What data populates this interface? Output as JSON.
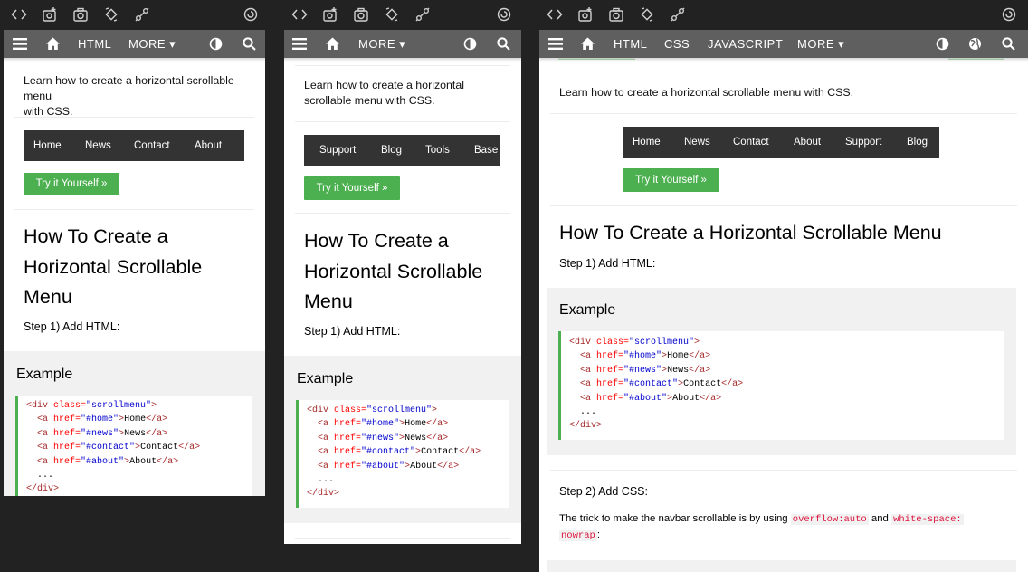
{
  "nav_left": {
    "html": "HTML",
    "more": "MORE ▾"
  },
  "nav_mid": {
    "more": "MORE ▾"
  },
  "nav_right": {
    "html": "HTML",
    "css": "CSS",
    "javascript": "JAVASCRIPT",
    "more": "MORE ▾"
  },
  "intro_text": "Learn how to create a horizontal scrollable menu with CSS.",
  "intro_line1": "Learn how to create a horizontal scrollable menu",
  "intro_line2": "with CSS.",
  "intro_mid_line1": "Learn how to create a horizontal",
  "intro_mid_line2": "scrollable menu with CSS.",
  "demo_left": [
    "Home",
    "News",
    "Contact",
    "About"
  ],
  "demo_mid": [
    "Support",
    "Blog",
    "Tools",
    "Base"
  ],
  "demo_right": [
    "Home",
    "News",
    "Contact",
    "About",
    "Support",
    "Blog"
  ],
  "tryit": "Try it Yourself »",
  "heading": "How To Create a Horizontal Scrollable Menu",
  "heading_lines": [
    "How To Create a",
    "Horizontal Scrollable",
    "Menu"
  ],
  "step1": "Step 1) Add HTML:",
  "example_title": "Example",
  "code": {
    "l1_open": "<div ",
    "l1_attr": "class=",
    "l1_val": "\"scrollmenu\"",
    "l1_close": ">",
    "home_attr": "href=",
    "home_val": "\"#home\"",
    "home_text": "Home",
    "news_val": "\"#news\"",
    "news_text": "News",
    "contact_val": "\"#contact\"",
    "contact_text": "Contact",
    "about_val": "\"#about\"",
    "about_text": "About",
    "a_open": "<a ",
    "a_close": "</a>",
    "gt": ">",
    "dots": "...",
    "div_close": "</div>"
  },
  "step2": "Step 2) Add CSS:",
  "trick_pre": "The trick to make the navbar scrollable is by using",
  "trick_code1": "overflow:auto",
  "trick_and": "and",
  "trick_code2a": "white-space:",
  "trick_code2b": "nowrap",
  "trick_end": ":",
  "colors": {
    "accent": "#4caf50",
    "topnav": "#5f5f5f",
    "demo_bg": "#333333",
    "example_bg": "#f1f1f1"
  }
}
